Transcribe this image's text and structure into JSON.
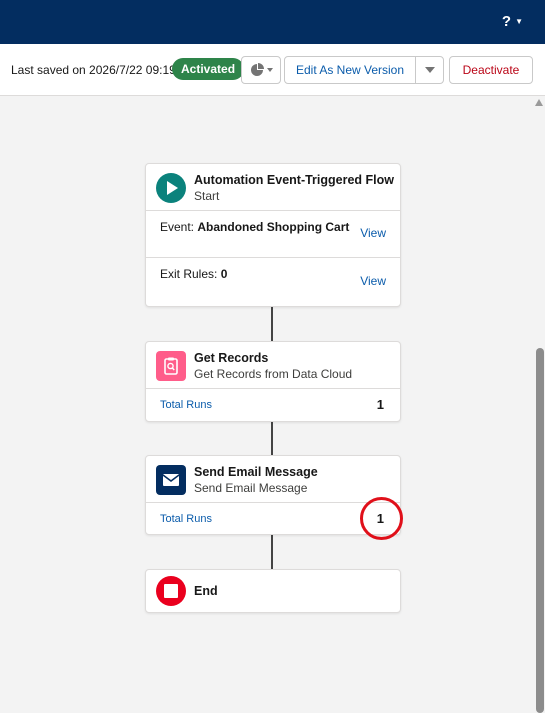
{
  "header": {
    "help_label": "?"
  },
  "toolbar": {
    "last_saved": "Last saved on 2026/7/22 09:19",
    "status_badge": "Activated",
    "edit_button": "Edit As New Version",
    "deactivate_button": "Deactivate"
  },
  "colors": {
    "topbar": "#032d60",
    "activated": "#2e844a",
    "start_icon": "#0b827c",
    "get_records_icon": "#ff5d8a",
    "email_icon": "#032d60",
    "end_icon": "#ea001e",
    "highlight": "#e0101a"
  },
  "flow": {
    "start": {
      "title": "Automation Event-Triggered Flow",
      "subtitle": "Start",
      "icon": "play-icon",
      "event_label": "Event:",
      "event_value": "Abandoned Shopping Cart",
      "event_link": "View",
      "exit_label": "Exit Rules:",
      "exit_value": "0",
      "exit_link": "View"
    },
    "get_records": {
      "title": "Get Records",
      "subtitle": "Get Records from Data Cloud",
      "icon": "clipboard-search-icon",
      "runs_label": "Total Runs",
      "runs_value": "1"
    },
    "send_email": {
      "title": "Send Email Message",
      "subtitle": "Send Email Message",
      "icon": "envelope-icon",
      "runs_label": "Total Runs",
      "runs_value": "1"
    },
    "end": {
      "title": "End",
      "icon": "stop-icon"
    }
  }
}
